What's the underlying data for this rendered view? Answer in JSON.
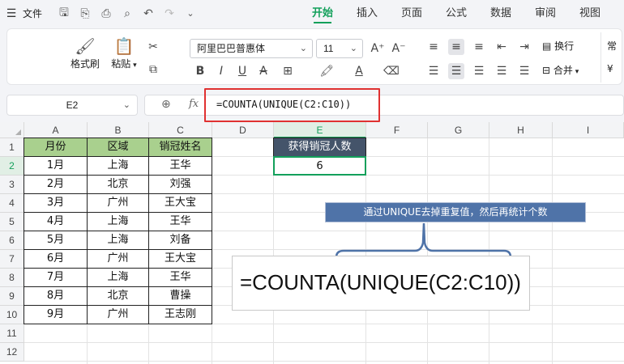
{
  "menubar": {
    "file_label": "文件",
    "tabs": [
      "开始",
      "插入",
      "页面",
      "公式",
      "数据",
      "审阅",
      "视图"
    ],
    "active_tab": "开始"
  },
  "ribbon": {
    "format_painter": "格式刷",
    "paste": "粘贴",
    "font_name": "阿里巴巴普惠体",
    "font_size": "11",
    "wrap": "换行",
    "merge": "合并",
    "number_format": "常"
  },
  "formula_bar": {
    "cell_ref": "E2",
    "fx": "fx",
    "formula": "=COUNTA(UNIQUE(C2:C10))"
  },
  "grid": {
    "columns": [
      "A",
      "B",
      "C",
      "D",
      "E",
      "F",
      "G",
      "H",
      "I"
    ],
    "selected_column": "E",
    "rows": [
      "1",
      "2",
      "3",
      "4",
      "5",
      "6",
      "7",
      "8",
      "9",
      "10",
      "11",
      "12"
    ],
    "selected_row": "2"
  },
  "table": {
    "headers": [
      "月份",
      "区域",
      "销冠姓名"
    ],
    "rows": [
      [
        "1月",
        "上海",
        "王华"
      ],
      [
        "2月",
        "北京",
        "刘强"
      ],
      [
        "3月",
        "广州",
        "王大宝"
      ],
      [
        "4月",
        "上海",
        "王华"
      ],
      [
        "5月",
        "上海",
        "刘备"
      ],
      [
        "6月",
        "广州",
        "王大宝"
      ],
      [
        "7月",
        "上海",
        "王华"
      ],
      [
        "8月",
        "北京",
        "曹操"
      ],
      [
        "9月",
        "广州",
        "王志刚"
      ]
    ]
  },
  "result": {
    "header": "获得销冠人数",
    "value": "6"
  },
  "annotation": {
    "callout": "通过UNIQUE去掉重复值，然后再统计个数",
    "big_formula": "=COUNTA(UNIQUE(C2:C10))"
  },
  "colors": {
    "accent": "#13a05b",
    "table_header": "#a9d08e",
    "result_header": "#44546a",
    "callout_bg": "#4f73a8",
    "highlight_box": "#e03131"
  }
}
